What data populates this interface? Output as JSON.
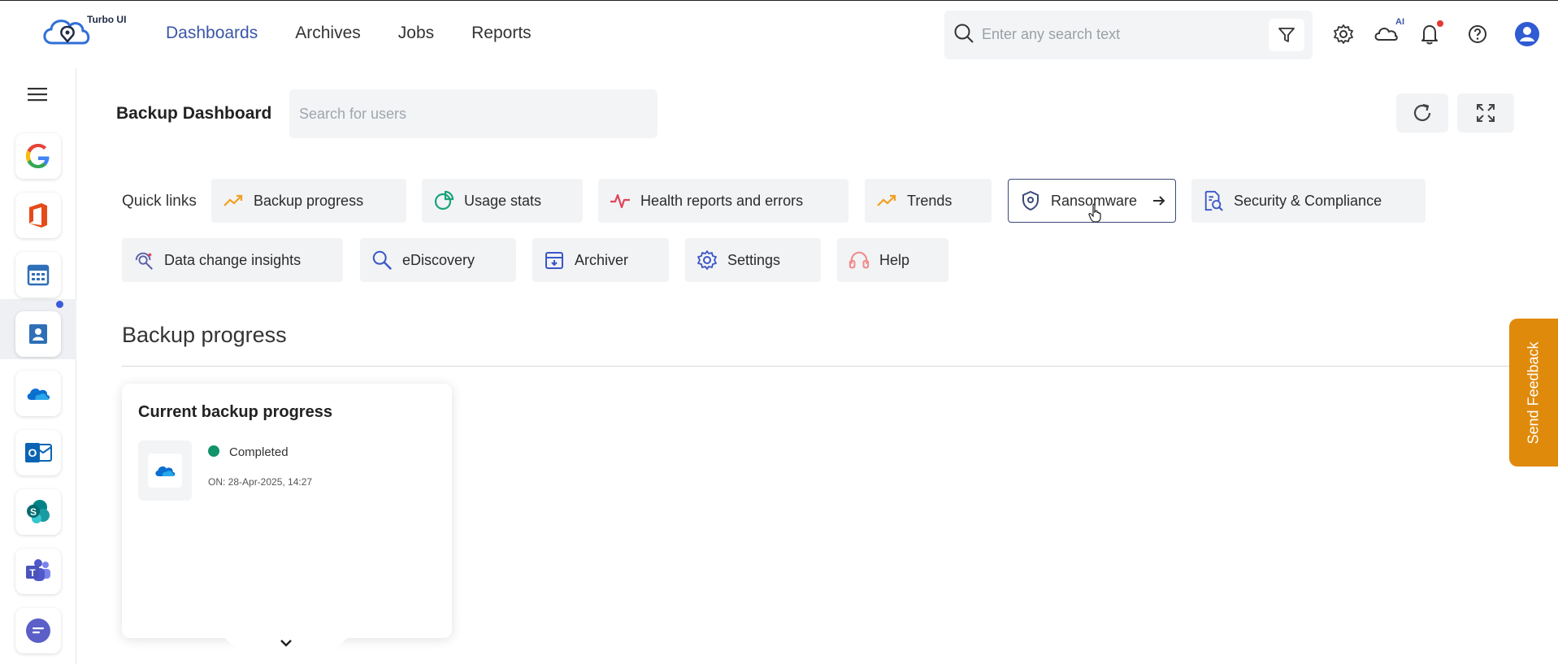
{
  "app": {
    "name": "Turbo UI"
  },
  "nav": {
    "items": [
      "Dashboards",
      "Archives",
      "Jobs",
      "Reports"
    ],
    "active": "Dashboards"
  },
  "top_search": {
    "placeholder": "Enter any search text"
  },
  "top_icons": {
    "ai_label": "AI"
  },
  "sidebar": {
    "apps": [
      "google-icon",
      "office-icon",
      "calendar-icon",
      "contacts-icon",
      "onedrive-icon",
      "outlook-icon",
      "sharepoint-icon",
      "teams-icon",
      "chat-icon"
    ],
    "active": "onedrive-icon"
  },
  "header": {
    "title": "Backup Dashboard",
    "user_search_placeholder": "Search for users"
  },
  "quick_links": {
    "label": "Quick links",
    "items": [
      "Backup progress",
      "Usage stats",
      "Health reports and errors",
      "Trends",
      "Ransomware",
      "Security & Compliance",
      "Data change insights",
      "eDiscovery",
      "Archiver",
      "Settings",
      "Help"
    ]
  },
  "section": {
    "title": "Backup progress"
  },
  "card": {
    "title": "Current backup progress",
    "status": "Completed",
    "time": "ON: 28-Apr-2025, 14:27",
    "status_color": "#12936a"
  },
  "feedback": {
    "label": "Send Feedback",
    "color": "#e08a0b"
  },
  "colors": {
    "accent": "#3a56a8"
  }
}
